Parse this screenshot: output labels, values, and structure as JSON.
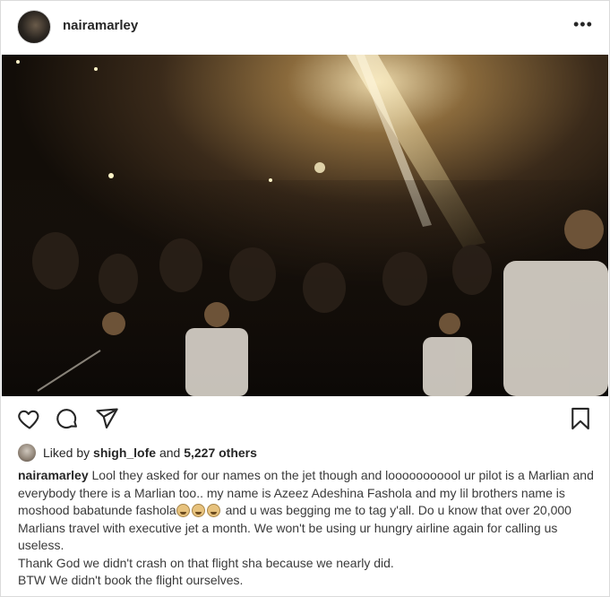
{
  "post": {
    "username": "nairamarley",
    "more_label": "•••"
  },
  "media": {
    "description_icon": "concert-stage-photo"
  },
  "actions": {
    "like_icon": "heart-icon",
    "comment_icon": "comment-icon",
    "share_icon": "share-icon",
    "save_icon": "bookmark-icon"
  },
  "likes": {
    "prefix": "Liked by ",
    "user": "shigh_lofe",
    "middle": " and ",
    "count": "5,227 others"
  },
  "caption": {
    "author": "nairamarley",
    "part1": " Lool they asked for our names on the jet though and looooooooool ur pilot is a Marlian and everybody there is a Marlian too.. my name is Azeez Adeshina Fashola and my lil brothers name is moshood babatunde fashola",
    "emoji_count": 3,
    "part2": " and u was begging me to tag y'all. Do u know that over 20,000 Marlians travel with executive jet a month. We won't be using ur hungry airline again for calling us useless.",
    "line2": "Thank God we didn't crash on that flight sha because we nearly did.",
    "line3": "BTW We didn't book the flight ourselves."
  },
  "colors": {
    "text": "#262626",
    "border": "#dbdbdb"
  }
}
